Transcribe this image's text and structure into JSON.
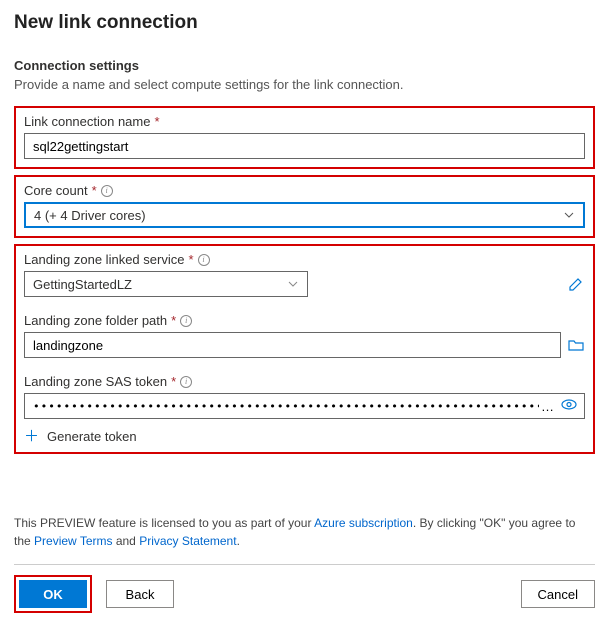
{
  "title": "New link connection",
  "section": {
    "heading": "Connection settings",
    "subtitle": "Provide a name and select compute settings for the link connection."
  },
  "fields": {
    "name": {
      "label": "Link connection name",
      "value": "sql22gettingstart"
    },
    "cores": {
      "label": "Core count",
      "value": "4 (+ 4 Driver cores)"
    },
    "lz_service": {
      "label": "Landing zone linked service",
      "value": "GettingStartedLZ"
    },
    "lz_path": {
      "label": "Landing zone folder path",
      "value": "landingzone"
    },
    "lz_sas": {
      "label": "Landing zone SAS token"
    },
    "gen_token": "Generate token"
  },
  "footer": {
    "text1": "This PREVIEW feature is licensed to you as part of your ",
    "link1": "Azure subscription",
    "text2": ". By clicking \"OK\" you agree to the ",
    "link2": "Preview Terms",
    "text3": " and ",
    "link3": "Privacy Statement",
    "text4": "."
  },
  "buttons": {
    "ok": "OK",
    "back": "Back",
    "cancel": "Cancel"
  },
  "required_mark": "*"
}
